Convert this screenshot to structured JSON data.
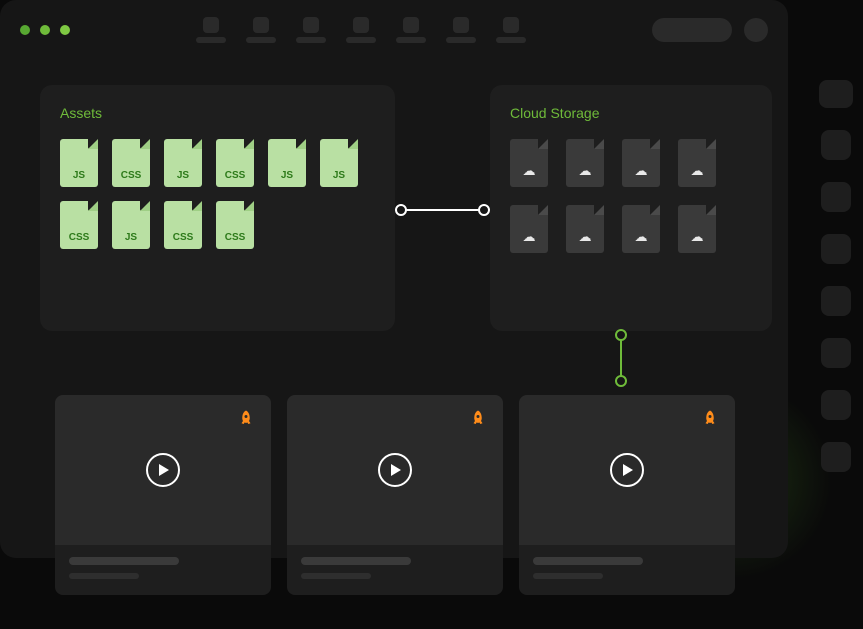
{
  "panels": {
    "assets": {
      "title": "Assets",
      "files": [
        {
          "type": "JS"
        },
        {
          "type": "CSS"
        },
        {
          "type": "JS"
        },
        {
          "type": "CSS"
        },
        {
          "type": "JS"
        },
        {
          "type": "JS"
        },
        {
          "type": "CSS"
        },
        {
          "type": "JS"
        },
        {
          "type": "CSS"
        },
        {
          "type": "CSS"
        }
      ]
    },
    "cloud": {
      "title": "Cloud Storage",
      "files": [
        {
          "icon": "cloud-upload"
        },
        {
          "icon": "cloud-upload"
        },
        {
          "icon": "cloud-upload"
        },
        {
          "icon": "cloud-upload"
        },
        {
          "icon": "cloud-upload"
        },
        {
          "icon": "cloud-upload"
        },
        {
          "icon": "cloud-upload"
        },
        {
          "icon": "cloud-upload"
        }
      ]
    }
  },
  "connectors": {
    "horizontal": {
      "from": "assets",
      "to": "cloud",
      "color": "#ffffff"
    },
    "vertical": {
      "from": "cloud",
      "to": "media-cards",
      "color": "#6fbb3a"
    }
  },
  "media_cards": [
    {
      "badge": "rocket",
      "action": "play"
    },
    {
      "badge": "rocket",
      "action": "play"
    },
    {
      "badge": "rocket",
      "action": "play"
    }
  ],
  "colors": {
    "accent_green": "#6fbb3a",
    "accent_orange": "#ff8c1a",
    "file_fill": "#b9e0a3",
    "file_text": "#2d7a1a"
  }
}
